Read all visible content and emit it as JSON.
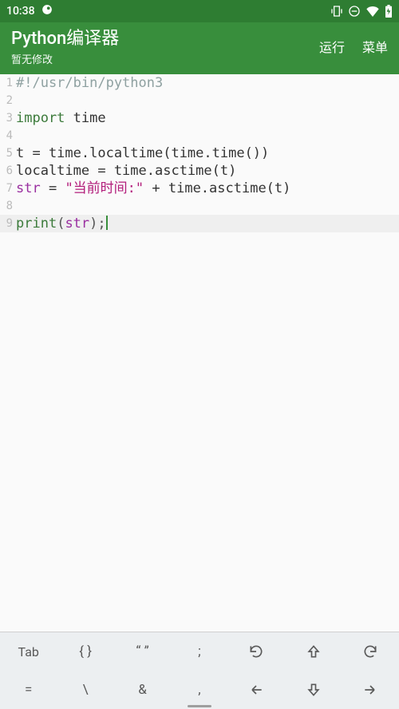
{
  "status": {
    "time": "10:38"
  },
  "appbar": {
    "title": "Python编译器",
    "subtitle": "暂无修改",
    "run": "运行",
    "menu": "菜单"
  },
  "code": {
    "l1_comment": "#!/usr/bin/python3",
    "l3_kw": "import",
    "l3_mod": " time",
    "l5_a": "t = time.localtime(time.time())",
    "l6_a": "localtime = time.asctime(t)",
    "l7_var": "str",
    "l7_eq": " = ",
    "l7_str": "\"当前时间:\"",
    "l7_rest": " + time.asctime(t)",
    "l9_print": "print",
    "l9_open": "(",
    "l9_arg": "str",
    "l9_close": ");"
  },
  "ln": {
    "1": "1",
    "2": "2",
    "3": "3",
    "4": "4",
    "5": "5",
    "6": "6",
    "7": "7",
    "8": "8",
    "9": "9"
  },
  "kbd": {
    "tab": "Tab",
    "braces": "{ }",
    "quotes": "“ ”",
    "semicolon": ";",
    "eq": "=",
    "backslash": "\\",
    "amp": "&",
    "comma": ","
  }
}
